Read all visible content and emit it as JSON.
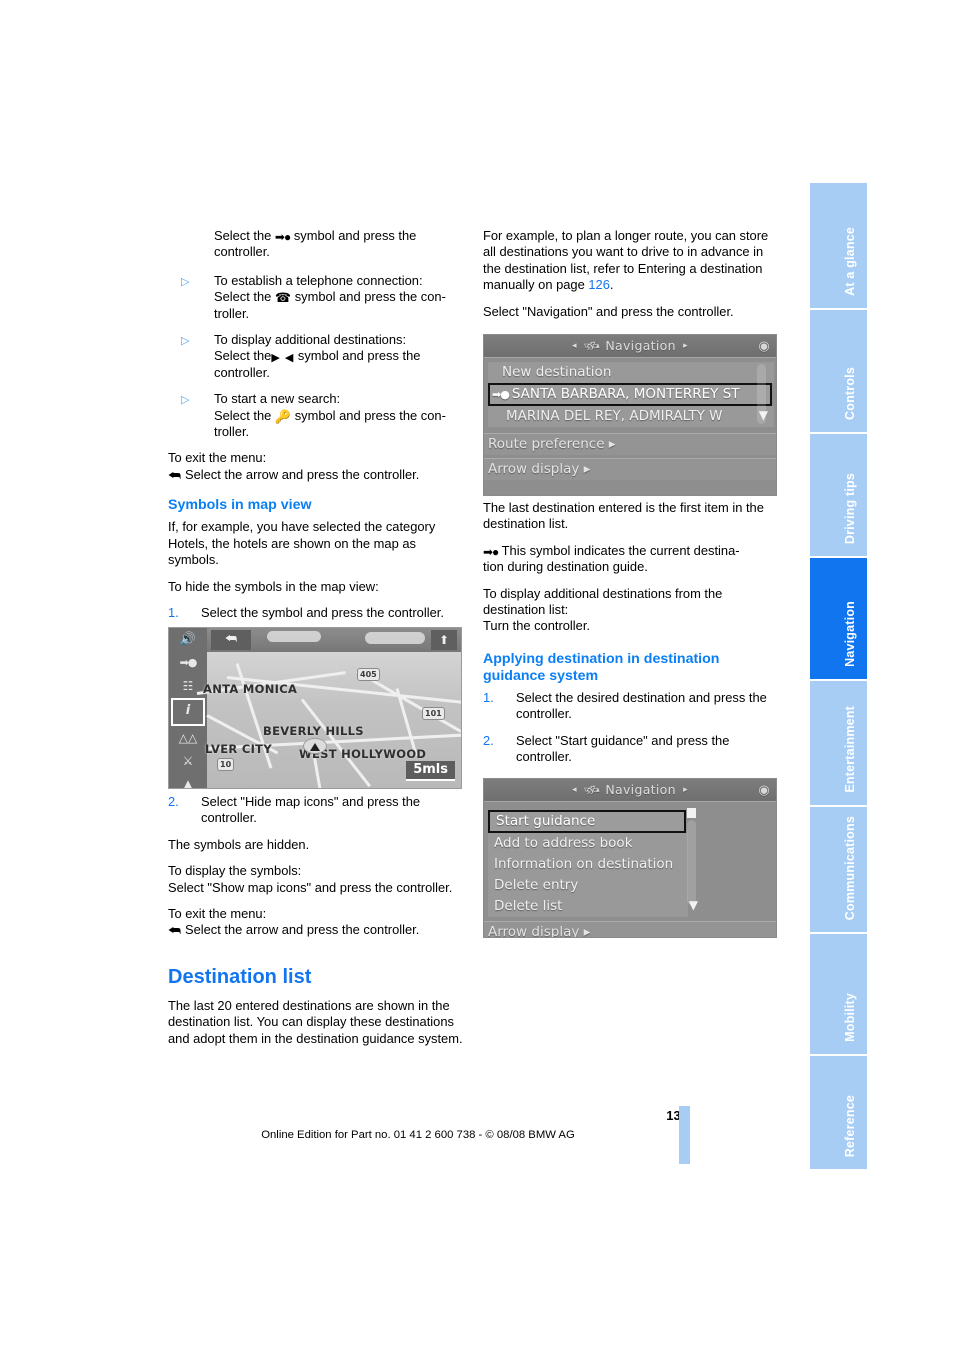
{
  "page": {
    "number": "133",
    "footer": "Online Edition for Part no. 01 41 2 600 738 - © 08/08 BMW AG"
  },
  "tabs": [
    {
      "label": "At a glance",
      "active": false
    },
    {
      "label": "Controls",
      "active": false
    },
    {
      "label": "Driving tips",
      "active": false
    },
    {
      "label": "Navigation",
      "active": true
    },
    {
      "label": "Entertainment",
      "active": false
    },
    {
      "label": "Communications",
      "active": false
    },
    {
      "label": "Mobility",
      "active": false
    },
    {
      "label": "Reference",
      "active": false
    }
  ],
  "colors": {
    "accent": "#1275f0",
    "heading": "#0a7ff5",
    "tab_inactive": "#a8cdf5",
    "tab_active": "#1275f0"
  },
  "left_column": {
    "intro": {
      "line1_pre": "Select the ",
      "line1_post": " symbol and press the",
      "line2": "controller."
    },
    "bullets": [
      {
        "marker": "▷",
        "title": "To establish a telephone connection:",
        "pre": "Select the ",
        "post": " symbol and press the con-",
        "tail": "troller.",
        "icon": "phone-icon"
      },
      {
        "marker": "▷",
        "title": "To display additional destinations:",
        "pre": "Select the",
        "post": " symbol and press the",
        "tail": "controller.",
        "icon": "left-right-arrows-icon"
      },
      {
        "marker": "▷",
        "title": "To start a new search:",
        "pre": "Select the ",
        "post": " symbol and press the con-",
        "tail": "troller.",
        "icon": "magnifier-key-icon"
      }
    ],
    "exit_menu_label": "To exit the menu:",
    "exit_menu_action": "Select the arrow and press the controller.",
    "symbols_heading": "Symbols in map view",
    "symbols_body": "If, for example, you have selected the category Hotels, the hotels are shown on the map as symbols.",
    "hide_label": "To hide the symbols in the map view:",
    "step1_num": "1.",
    "step1_text": "Select the symbol and press the controller.",
    "step2_num": "2.",
    "step2_text": "Select \"Hide map icons\" and press the controller.",
    "hidden_text": "The symbols are hidden.",
    "display_label": "To display the symbols:",
    "display_action": "Select \"Show map icons\" and press the controller.",
    "exit_menu_label2": "To exit the menu:",
    "exit_menu_action2": "Select the arrow and press the controller.",
    "destination_heading": "Destination list",
    "destination_body": "The last 20 entered destinations are shown in the destination list. You can display these destinations and adopt them in the destination guidance system."
  },
  "right_column": {
    "intro": "For example, to plan a longer route, you can store all destinations you want to drive to in advance in the destination list, refer to Entering a destination manually on page ",
    "intro_pageref": "126",
    "intro_period": ".",
    "select_nav": "Select \"Navigation\" and press the controller.",
    "after_screen_1": "The last destination entered is the first item in the destination list.",
    "symbol_note_pre": " This symbol indicates the current destina-",
    "symbol_note_post": "tion during destination guide.",
    "display_more_label": "To display additional destinations from the destination list:",
    "display_more_action": "Turn the controller.",
    "applying_heading": "Applying destination in destination guidance system",
    "applying_steps": [
      {
        "num": "1.",
        "text": "Select the desired destination and press the controller."
      },
      {
        "num": "2.",
        "text": "Select \"Start guidance\" and press the controller."
      }
    ]
  },
  "screen_destination_list": {
    "title": "Navigation",
    "title_icon": "satellite-icon",
    "corner_icon": "joystick-icon",
    "arrow_left": "◂",
    "arrow_right": "▸",
    "rows": [
      {
        "label": "New destination",
        "selected": false,
        "dest_glyph": ""
      },
      {
        "label": "SANTA BARBARA, MONTERREY ST",
        "selected": true,
        "dest_glyph": "➡●"
      },
      {
        "label": "MARINA DEL REY, ADMIRALTY W",
        "selected": false,
        "dest_glyph": ""
      }
    ],
    "footer_rows": [
      "Route preference ▸",
      "Arrow display ▸"
    ]
  },
  "screen_destination_menu": {
    "title": "Navigation",
    "title_icon": "satellite-icon",
    "corner_icon": "joystick-icon",
    "arrow_left": "◂",
    "arrow_right": "▸",
    "rows": [
      {
        "label": "Start guidance",
        "selected": true
      },
      {
        "label": "Add to address book",
        "selected": false
      },
      {
        "label": "Information on destination",
        "selected": false
      },
      {
        "label": "Delete entry",
        "selected": false
      },
      {
        "label": "Delete list",
        "selected": false
      }
    ],
    "footer_rows": [
      "Arrow display ▸"
    ]
  },
  "map_figure": {
    "icons": [
      "speaker-icon",
      "destination-arrow-icon",
      "split-screen-icon",
      "info-icon",
      "road-icon",
      "poi-icon",
      "warning-icon"
    ],
    "selected_icon": "info-icon",
    "back_icon": "back-arrow-icon",
    "compass_icon": "north-arrow-icon",
    "scale": "5mls",
    "cities": [
      "ANTA MONICA",
      "BEVERLY HILLS",
      "LVER CITY",
      "WEST HOLLYWOOD"
    ],
    "shields": [
      "405",
      "101",
      "10"
    ]
  }
}
